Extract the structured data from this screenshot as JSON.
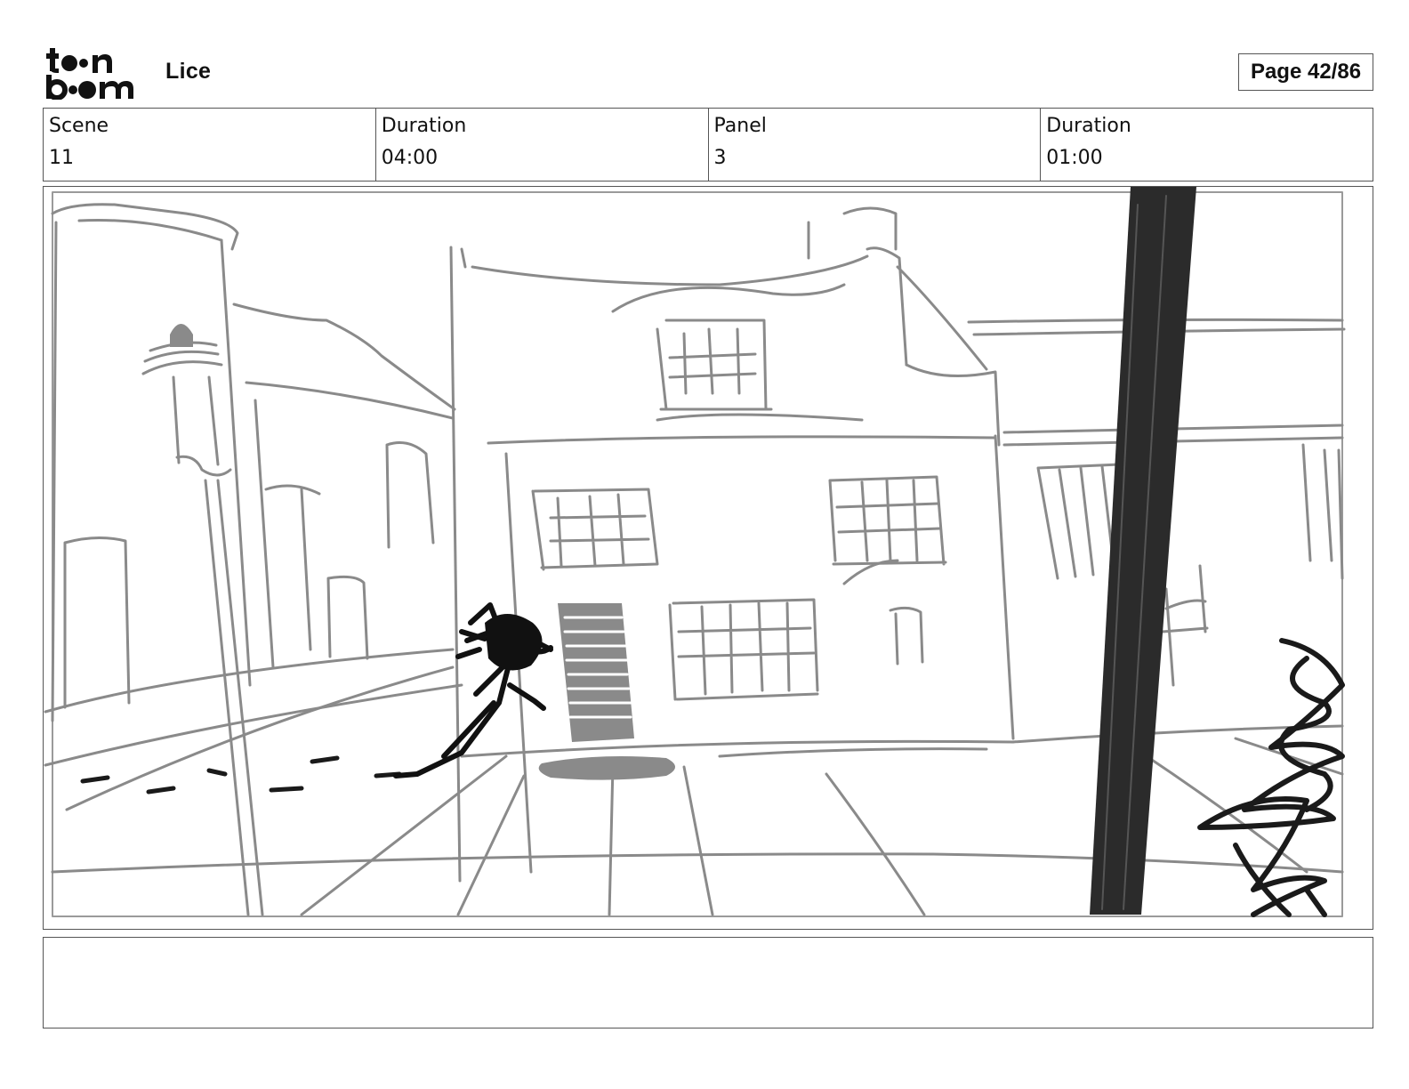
{
  "header": {
    "logo_text": "toon boom",
    "project_title": "Lice",
    "page_indicator": "Page 42/86"
  },
  "info": [
    {
      "label": "Scene",
      "value": "11"
    },
    {
      "label": "Duration",
      "value": "04:00"
    },
    {
      "label": "Panel",
      "value": "3"
    },
    {
      "label": "Duration",
      "value": "01:00"
    }
  ],
  "notes": "",
  "colors": {
    "border": "#555555",
    "sketch_gray": "#8a8a8a",
    "sketch_dark": "#2b2b2b",
    "ink": "#111111"
  }
}
